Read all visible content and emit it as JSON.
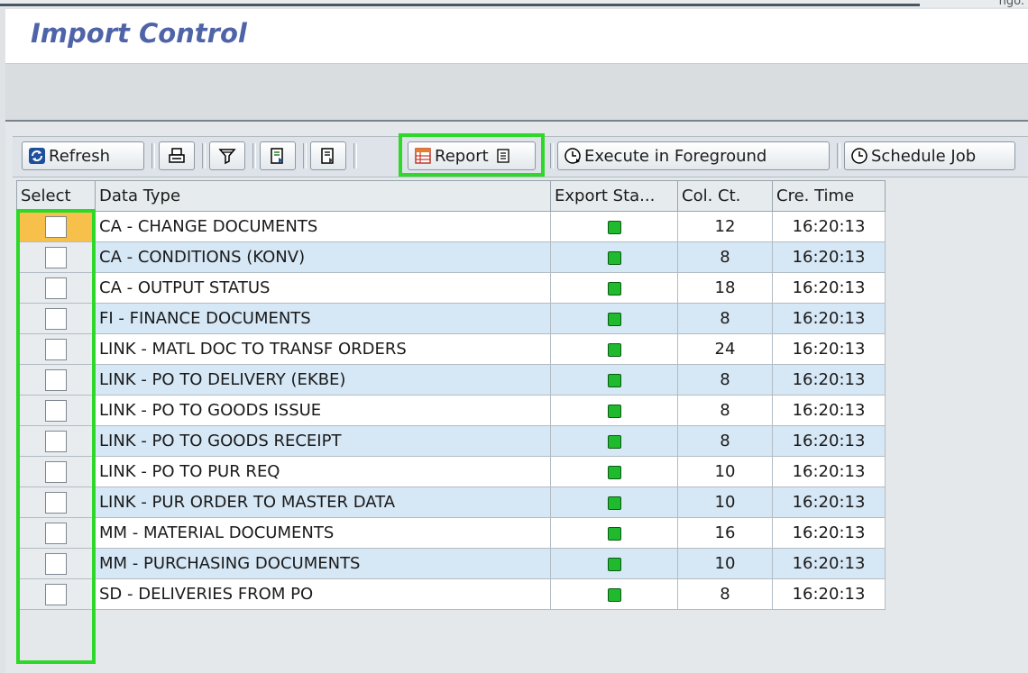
{
  "window": {
    "title": "Import Control",
    "corner_text": "ngo."
  },
  "toolbar": {
    "refresh_label": "Refresh",
    "report_label": "Report",
    "execute_label": "Execute in Foreground",
    "schedule_label": "Schedule Job"
  },
  "table": {
    "headers": {
      "select": "Select",
      "data_type": "Data Type",
      "export_status": "Export Sta...",
      "col_ct": "Col. Ct.",
      "cre_time": "Cre. Time"
    },
    "rows": [
      {
        "data_type": "CA - CHANGE DOCUMENTS",
        "col_ct": "12",
        "cre_time": "16:20:13"
      },
      {
        "data_type": "CA - CONDITIONS (KONV)",
        "col_ct": "8",
        "cre_time": "16:20:13"
      },
      {
        "data_type": "CA - OUTPUT STATUS",
        "col_ct": "18",
        "cre_time": "16:20:13"
      },
      {
        "data_type": "FI - FINANCE DOCUMENTS",
        "col_ct": "8",
        "cre_time": "16:20:13"
      },
      {
        "data_type": "LINK - MATL DOC TO TRANSF ORDERS",
        "col_ct": "24",
        "cre_time": "16:20:13"
      },
      {
        "data_type": "LINK - PO TO DELIVERY (EKBE)",
        "col_ct": "8",
        "cre_time": "16:20:13"
      },
      {
        "data_type": "LINK - PO TO GOODS ISSUE",
        "col_ct": "8",
        "cre_time": "16:20:13"
      },
      {
        "data_type": "LINK - PO TO GOODS RECEIPT",
        "col_ct": "8",
        "cre_time": "16:20:13"
      },
      {
        "data_type": "LINK - PO TO PUR REQ",
        "col_ct": "10",
        "cre_time": "16:20:13"
      },
      {
        "data_type": "LINK - PUR ORDER TO MASTER DATA",
        "col_ct": "10",
        "cre_time": "16:20:13"
      },
      {
        "data_type": "MM - MATERIAL DOCUMENTS",
        "col_ct": "16",
        "cre_time": "16:20:13"
      },
      {
        "data_type": "MM - PURCHASING DOCUMENTS",
        "col_ct": "10",
        "cre_time": "16:20:13"
      },
      {
        "data_type": "SD - DELIVERIES FROM PO",
        "col_ct": "8",
        "cre_time": "16:20:13"
      }
    ]
  },
  "colors": {
    "title": "#4f64a8",
    "highlight": "#2ed829",
    "status_green": "#1fba2e",
    "row_alt": "#d6e7f5"
  },
  "icons": [
    "refresh-icon",
    "print-icon",
    "filter-icon",
    "export-icon",
    "layout-icon",
    "report-icon",
    "dropdown-icon",
    "clock-icon",
    "status-green-icon"
  ]
}
